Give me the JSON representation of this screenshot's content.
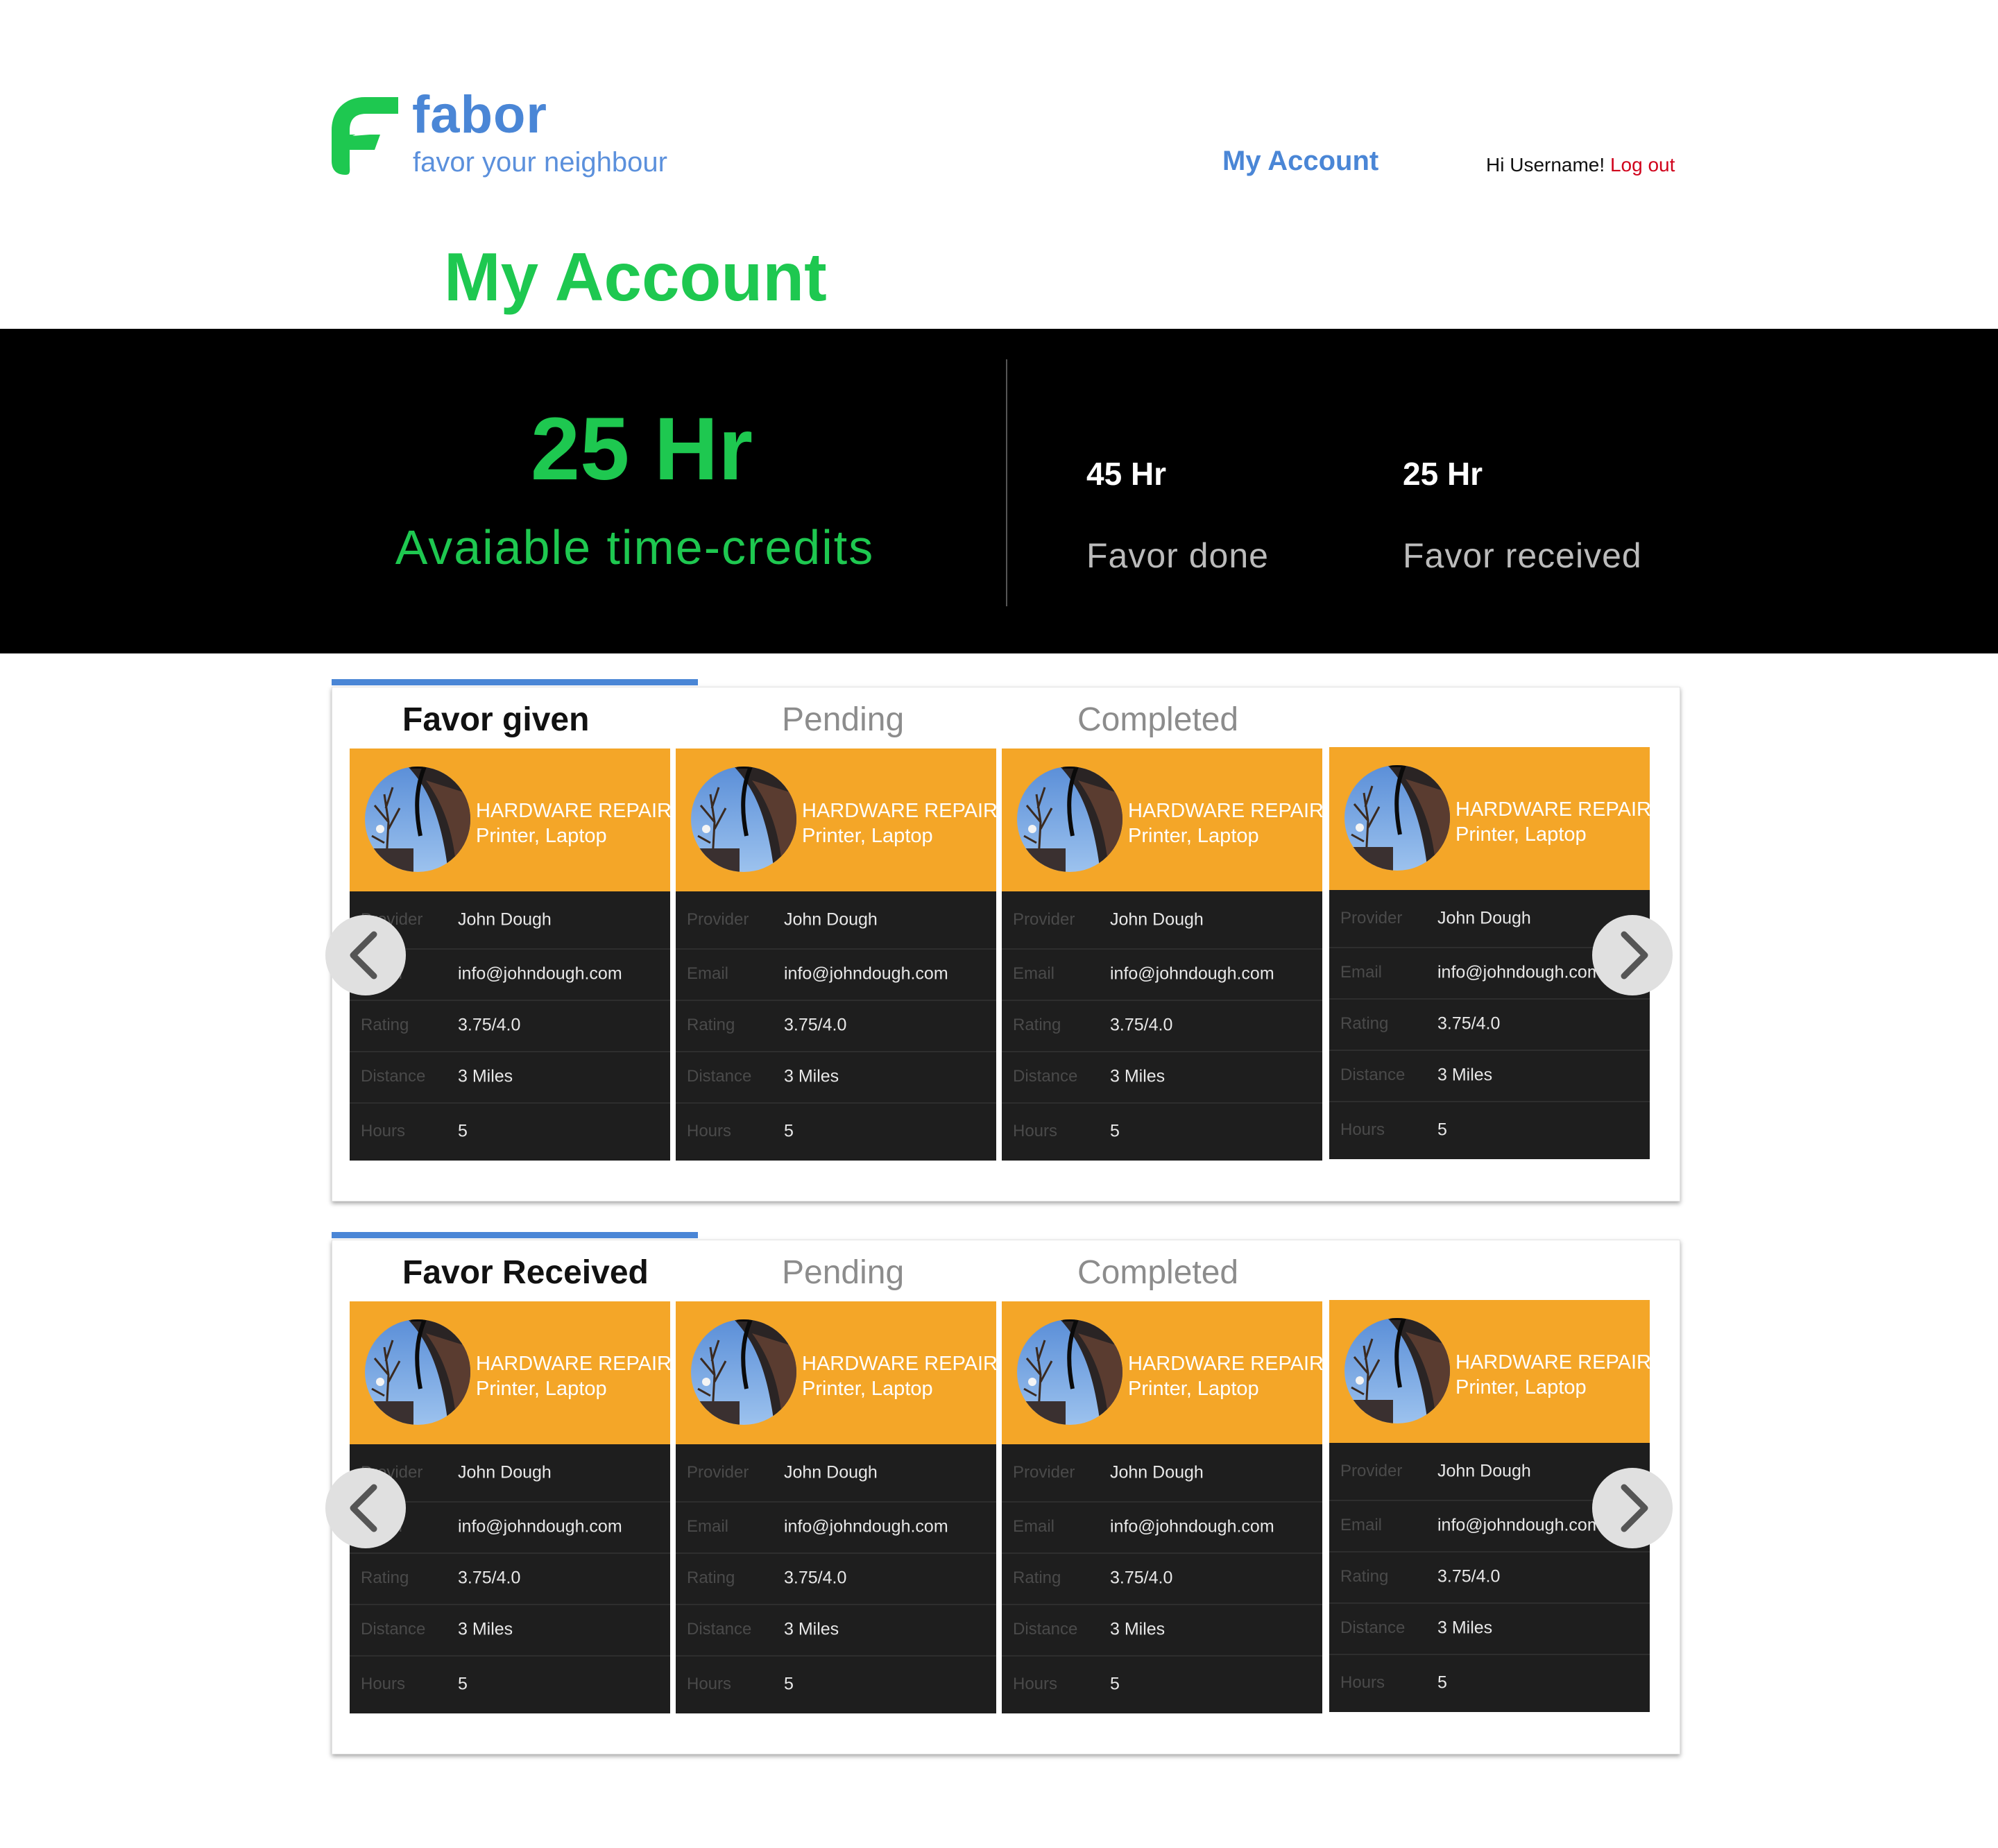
{
  "header": {
    "brand_name": "fabor",
    "tagline": "favor your neighbour",
    "nav_my_account": "My Account",
    "greeting": "Hi Username!",
    "logout": "Log out"
  },
  "page_title": "My Account",
  "stats": {
    "available_value": "25 Hr",
    "available_label": "Avaiable time-credits",
    "favor_done_value": "45 Hr",
    "favor_done_label": "Favor done",
    "favor_received_value": "25 Hr",
    "favor_received_label": "Favor received"
  },
  "colors": {
    "brand_blue": "#4a86d6",
    "brand_green": "#1ec850",
    "card_orange": "#f4a628",
    "logout_red": "#d0021b"
  },
  "panels": [
    {
      "tabs": [
        "Favor given",
        "Pending",
        "Completed"
      ],
      "active_tab": "Favor given",
      "prev_icon": "chevron-left-icon",
      "next_icon": "chevron-right-icon",
      "cards": [
        {
          "title": "HARDWARE REPAIR",
          "subtitle": "Printer, Laptop",
          "rows": [
            {
              "label": "Provider",
              "value": "John Dough"
            },
            {
              "label": "Email",
              "value": "info@johndough.com"
            },
            {
              "label": "Rating",
              "value": "3.75/4.0"
            },
            {
              "label": "Distance",
              "value": "3 Miles"
            },
            {
              "label": "Hours",
              "value": "5"
            }
          ]
        },
        {
          "title": "HARDWARE REPAIR",
          "subtitle": "Printer, Laptop",
          "rows": [
            {
              "label": "Provider",
              "value": "John Dough"
            },
            {
              "label": "Email",
              "value": "info@johndough.com"
            },
            {
              "label": "Rating",
              "value": "3.75/4.0"
            },
            {
              "label": "Distance",
              "value": "3 Miles"
            },
            {
              "label": "Hours",
              "value": "5"
            }
          ]
        },
        {
          "title": "HARDWARE REPAIR",
          "subtitle": "Printer, Laptop",
          "rows": [
            {
              "label": "Provider",
              "value": "John Dough"
            },
            {
              "label": "Email",
              "value": "info@johndough.com"
            },
            {
              "label": "Rating",
              "value": "3.75/4.0"
            },
            {
              "label": "Distance",
              "value": "3 Miles"
            },
            {
              "label": "Hours",
              "value": "5"
            }
          ]
        },
        {
          "title": "HARDWARE REPAIR",
          "subtitle": "Printer, Laptop",
          "rows": [
            {
              "label": "Provider",
              "value": "John Dough"
            },
            {
              "label": "Email",
              "value": "info@johndough.com"
            },
            {
              "label": "Rating",
              "value": "3.75/4.0"
            },
            {
              "label": "Distance",
              "value": "3 Miles"
            },
            {
              "label": "Hours",
              "value": "5"
            }
          ]
        }
      ]
    },
    {
      "tabs": [
        "Favor Received",
        "Pending",
        "Completed"
      ],
      "active_tab": "Favor Received",
      "prev_icon": "chevron-left-icon",
      "next_icon": "chevron-right-icon",
      "cards": [
        {
          "title": "HARDWARE REPAIR",
          "subtitle": "Printer, Laptop",
          "rows": [
            {
              "label": "Provider",
              "value": "John Dough"
            },
            {
              "label": "Email",
              "value": "info@johndough.com"
            },
            {
              "label": "Rating",
              "value": "3.75/4.0"
            },
            {
              "label": "Distance",
              "value": "3 Miles"
            },
            {
              "label": "Hours",
              "value": "5"
            }
          ]
        },
        {
          "title": "HARDWARE REPAIR",
          "subtitle": "Printer, Laptop",
          "rows": [
            {
              "label": "Provider",
              "value": "John Dough"
            },
            {
              "label": "Email",
              "value": "info@johndough.com"
            },
            {
              "label": "Rating",
              "value": "3.75/4.0"
            },
            {
              "label": "Distance",
              "value": "3 Miles"
            },
            {
              "label": "Hours",
              "value": "5"
            }
          ]
        },
        {
          "title": "HARDWARE REPAIR",
          "subtitle": "Printer, Laptop",
          "rows": [
            {
              "label": "Provider",
              "value": "John Dough"
            },
            {
              "label": "Email",
              "value": "info@johndough.com"
            },
            {
              "label": "Rating",
              "value": "3.75/4.0"
            },
            {
              "label": "Distance",
              "value": "3 Miles"
            },
            {
              "label": "Hours",
              "value": "5"
            }
          ]
        },
        {
          "title": "HARDWARE REPAIR",
          "subtitle": "Printer, Laptop",
          "rows": [
            {
              "label": "Provider",
              "value": "John Dough"
            },
            {
              "label": "Email",
              "value": "info@johndough.com"
            },
            {
              "label": "Rating",
              "value": "3.75/4.0"
            },
            {
              "label": "Distance",
              "value": "3 Miles"
            },
            {
              "label": "Hours",
              "value": "5"
            }
          ]
        }
      ]
    }
  ]
}
